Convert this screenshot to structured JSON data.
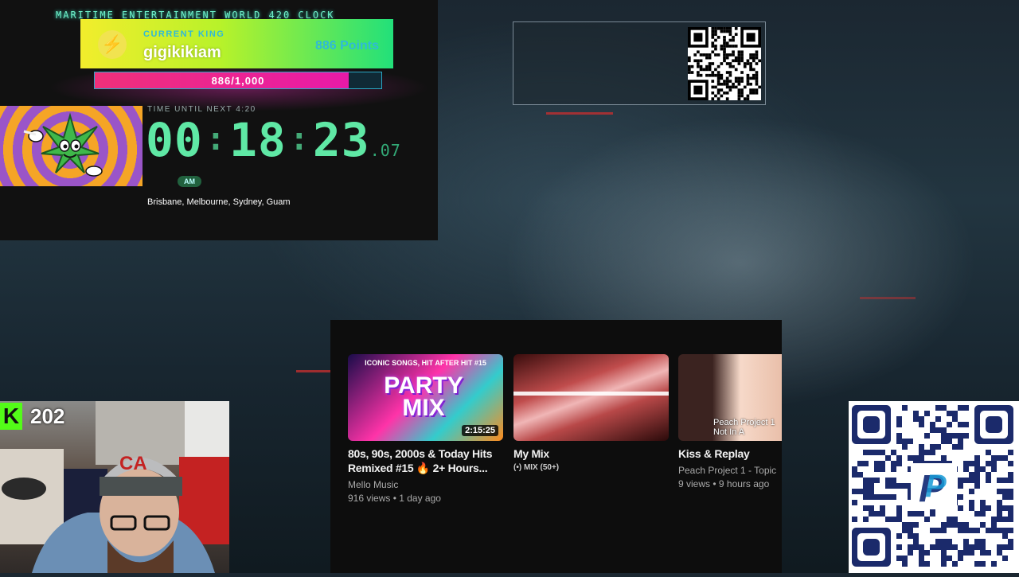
{
  "clock": {
    "title": "MARITIME ENTERTAINMENT WORLD 420 CLOCK",
    "king_label": "CURRENT KING",
    "king_name": "gigikikiam",
    "king_points": "886 Points",
    "progress_text": "886/1,000",
    "progress_value": 0.886,
    "time_until_label": "TIME UNTIL NEXT 4:20",
    "hours": "00",
    "minutes": "18",
    "seconds": "23",
    "fraction": ".07",
    "meridiem": "AM",
    "cities": "Brisbane, Melbourne, Sydney, Guam"
  },
  "youtube": {
    "cards": [
      {
        "title": "80s, 90s, 2000s & Today Hits Remixed #15 🔥 2+ Hours...",
        "channel": "Mello Music",
        "meta": "916 views • 1 day ago",
        "thumb_top": "ICONIC SONGS, HIT AFTER HIT  #15",
        "thumb_main": "PARTY MIX",
        "duration": "2:15:25"
      },
      {
        "title": "My Mix",
        "badge": "(•) MIX (50+)"
      },
      {
        "title": "Kiss & Replay",
        "channel": "Peach Project 1 - Topic",
        "meta": "9 views • 9 hours ago",
        "thumb_text": "Peach Project 1\nNot In A"
      }
    ]
  },
  "webcam": {
    "viewer_count": "202",
    "platform_letter": "K"
  },
  "colors": {
    "accent_green": "#5fe8a5",
    "kick_green": "#53fc18",
    "progress_pink": "#e81aa8"
  }
}
